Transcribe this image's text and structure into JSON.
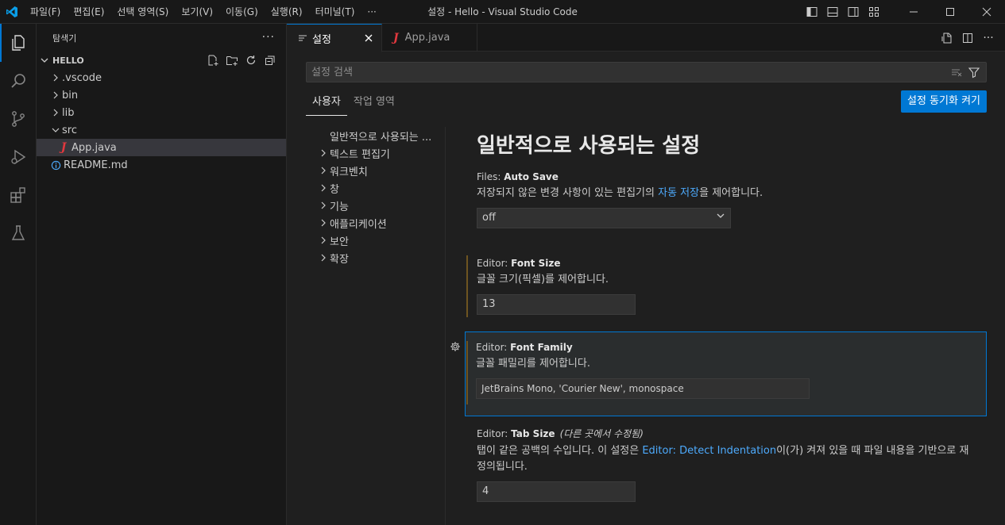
{
  "window": {
    "title": "설정 - Hello - Visual Studio Code",
    "menu": [
      "파일(F)",
      "편집(E)",
      "선택 영역(S)",
      "보기(V)",
      "이동(G)",
      "실행(R)",
      "터미널(T)",
      "···"
    ]
  },
  "activity": {
    "items": [
      "explorer-icon",
      "search-icon",
      "source-control-icon",
      "run-debug-icon",
      "extensions-icon",
      "testing-icon"
    ]
  },
  "sidebar": {
    "title": "탐색기",
    "more": "···",
    "folder": "HELLO",
    "tree": [
      {
        "label": ".vscode",
        "type": "folder"
      },
      {
        "label": "bin",
        "type": "folder"
      },
      {
        "label": "lib",
        "type": "folder"
      },
      {
        "label": "src",
        "type": "folder-open"
      },
      {
        "label": "App.java",
        "type": "java"
      },
      {
        "label": "README.md",
        "type": "info"
      }
    ]
  },
  "tabs": [
    {
      "label": "설정",
      "active": true
    },
    {
      "label": "App.java",
      "active": false
    }
  ],
  "search": {
    "placeholder": "설정 검색"
  },
  "scope": {
    "user": "사용자",
    "workspace": "작업 영역",
    "sync_button": "설정 동기화 켜기"
  },
  "toc": {
    "first": "일반적으로 사용되는 ...",
    "items": [
      "텍스트 편집기",
      "워크벤치",
      "창",
      "기능",
      "애플리케이션",
      "보안",
      "확장"
    ]
  },
  "settings": {
    "section_title": "일반적으로 사용되는 설정",
    "auto_save": {
      "category": "Files: ",
      "name": "Auto Save",
      "desc_before": "저장되지 않은 변경 사항이 있는 편집기의 ",
      "desc_link": "자동 저장",
      "desc_after": "을 제어합니다.",
      "value": "off"
    },
    "font_size": {
      "category": "Editor: ",
      "name": "Font Size",
      "desc": "글꼴 크기(픽셀)를 제어합니다.",
      "value": "13"
    },
    "font_family": {
      "category": "Editor: ",
      "name": "Font Family",
      "desc": "글꼴 패밀리를 제어합니다.",
      "value": "JetBrains Mono, 'Courier New', monospace"
    },
    "tab_size": {
      "category": "Editor: ",
      "name": "Tab Size",
      "note": "(다른 곳에서 수정됨)",
      "desc_before": "탭이 같은 공백의 수입니다. 이 설정은 ",
      "desc_link": "Editor: Detect Indentation",
      "desc_after": "이(가) 켜져 있을 때 파일 내용을 기반으로 재정의됩니다.",
      "value": "4"
    }
  },
  "colors": {
    "accent": "#0078d4",
    "link": "#4daafc",
    "modified": "#6e5420",
    "java": "#e0383e"
  }
}
